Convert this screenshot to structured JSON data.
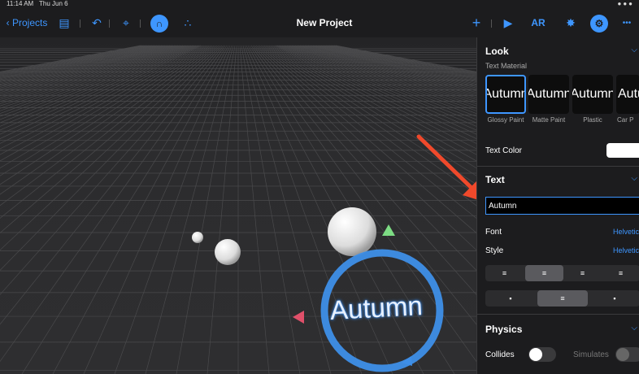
{
  "status_bar": {
    "time": "11:14 AM",
    "date": "Thu Jun 6",
    "icons": "●●●"
  },
  "toolbar": {
    "back_label": "‹ Projects",
    "title": "New Project",
    "ar_label": "AR",
    "add_glyph": "+",
    "play_glyph": "▶",
    "more_glyph": "•••",
    "undo_glyph": "↶",
    "sidebar_glyph": "▤",
    "capture_glyph": "⌖",
    "anchor_glyph": "∩",
    "objects_glyph": "∴",
    "move_glyph": "✸",
    "settings_glyph": "⚙"
  },
  "viewport": {
    "object_text": "Autumn"
  },
  "panel": {
    "look": {
      "header": "Look",
      "text_material_label": "Text Material",
      "materials": [
        {
          "name": "Glossy Paint",
          "preview": "Autumn"
        },
        {
          "name": "Matte Paint",
          "preview": "Autumn"
        },
        {
          "name": "Plastic",
          "preview": "Autumn"
        },
        {
          "name": "Car P",
          "preview": "Autu"
        }
      ],
      "selected_material": "Glossy Paint",
      "text_color_label": "Text Color",
      "text_color_value": "#ffffff"
    },
    "text": {
      "header": "Text",
      "value": "Autumn",
      "font_label": "Font",
      "font_value": "Helvetic",
      "style_label": "Style",
      "style_value": "Helvetic",
      "alignment_options": [
        "≡",
        "≡",
        "≡",
        "≡"
      ],
      "alignment_selected": 1,
      "vertical_options": [
        "▪",
        "≡",
        "▪"
      ],
      "vertical_selected": 1
    },
    "physics": {
      "header": "Physics",
      "collides_label": "Collides",
      "collides_on": false,
      "simulates_label": "Simulates",
      "simulates_on": false
    }
  },
  "colors": {
    "accent": "#3e96ff",
    "panel_bg": "#1c1c1e",
    "viewport_bg": "#2a2a2c",
    "annotation_arrow": "#f0492b"
  }
}
